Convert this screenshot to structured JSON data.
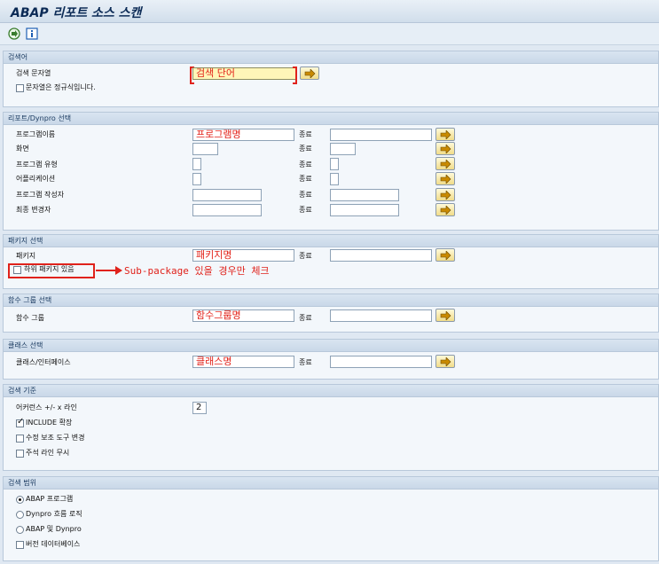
{
  "window": {
    "title": "ABAP 리포트 소스 스캔"
  },
  "toolbar": {
    "icons": [
      "execute-icon",
      "info-icon"
    ]
  },
  "search_term": {
    "header": "검색어",
    "field_label": "검색 문자열",
    "value": "검색 단어",
    "regex_label": "문자열은 정규식입니다."
  },
  "report_dynpro": {
    "header": "리포트/Dynpro 선택",
    "to_label": "종료",
    "rows": [
      {
        "label": "프로그램이름",
        "value": "프로그램명"
      },
      {
        "label": "화면",
        "value": ""
      },
      {
        "label": "프로그램 유형",
        "value": ""
      },
      {
        "label": "어플리케이션",
        "value": ""
      },
      {
        "label": "프로그램 작성자",
        "value": ""
      },
      {
        "label": "최종 변경자",
        "value": ""
      }
    ]
  },
  "package": {
    "header": "패키지 선택",
    "field_label": "패키지",
    "value": "패키지명",
    "to_label": "종료",
    "subpkg_label": "하위 패키지 있음",
    "annotation": "Sub-package 있을 경우만 체크"
  },
  "function_group": {
    "header": "함수 그룹 선택",
    "field_label": "함수 그룹",
    "value": "함수그룹명",
    "to_label": "종료"
  },
  "class": {
    "header": "클래스 선택",
    "field_label": "클래스/인터페이스",
    "value": "클래스명",
    "to_label": "종료"
  },
  "criteria": {
    "header": "검색 기준",
    "lines_label": "어커런스 +/- x 라인",
    "lines_value": "2",
    "include_label": "INCLUDE 확장",
    "include_checked": true,
    "modassist_label": "수정 보조 도구 변경",
    "comment_label": "주석 라인 무시"
  },
  "scope": {
    "header": "검색 범위",
    "options": [
      "ABAP 프로그램",
      "Dynpro 흐름 로직",
      "ABAP 및 Dynpro"
    ],
    "selected_index": 0,
    "version_label": "버전 데이터베이스"
  }
}
